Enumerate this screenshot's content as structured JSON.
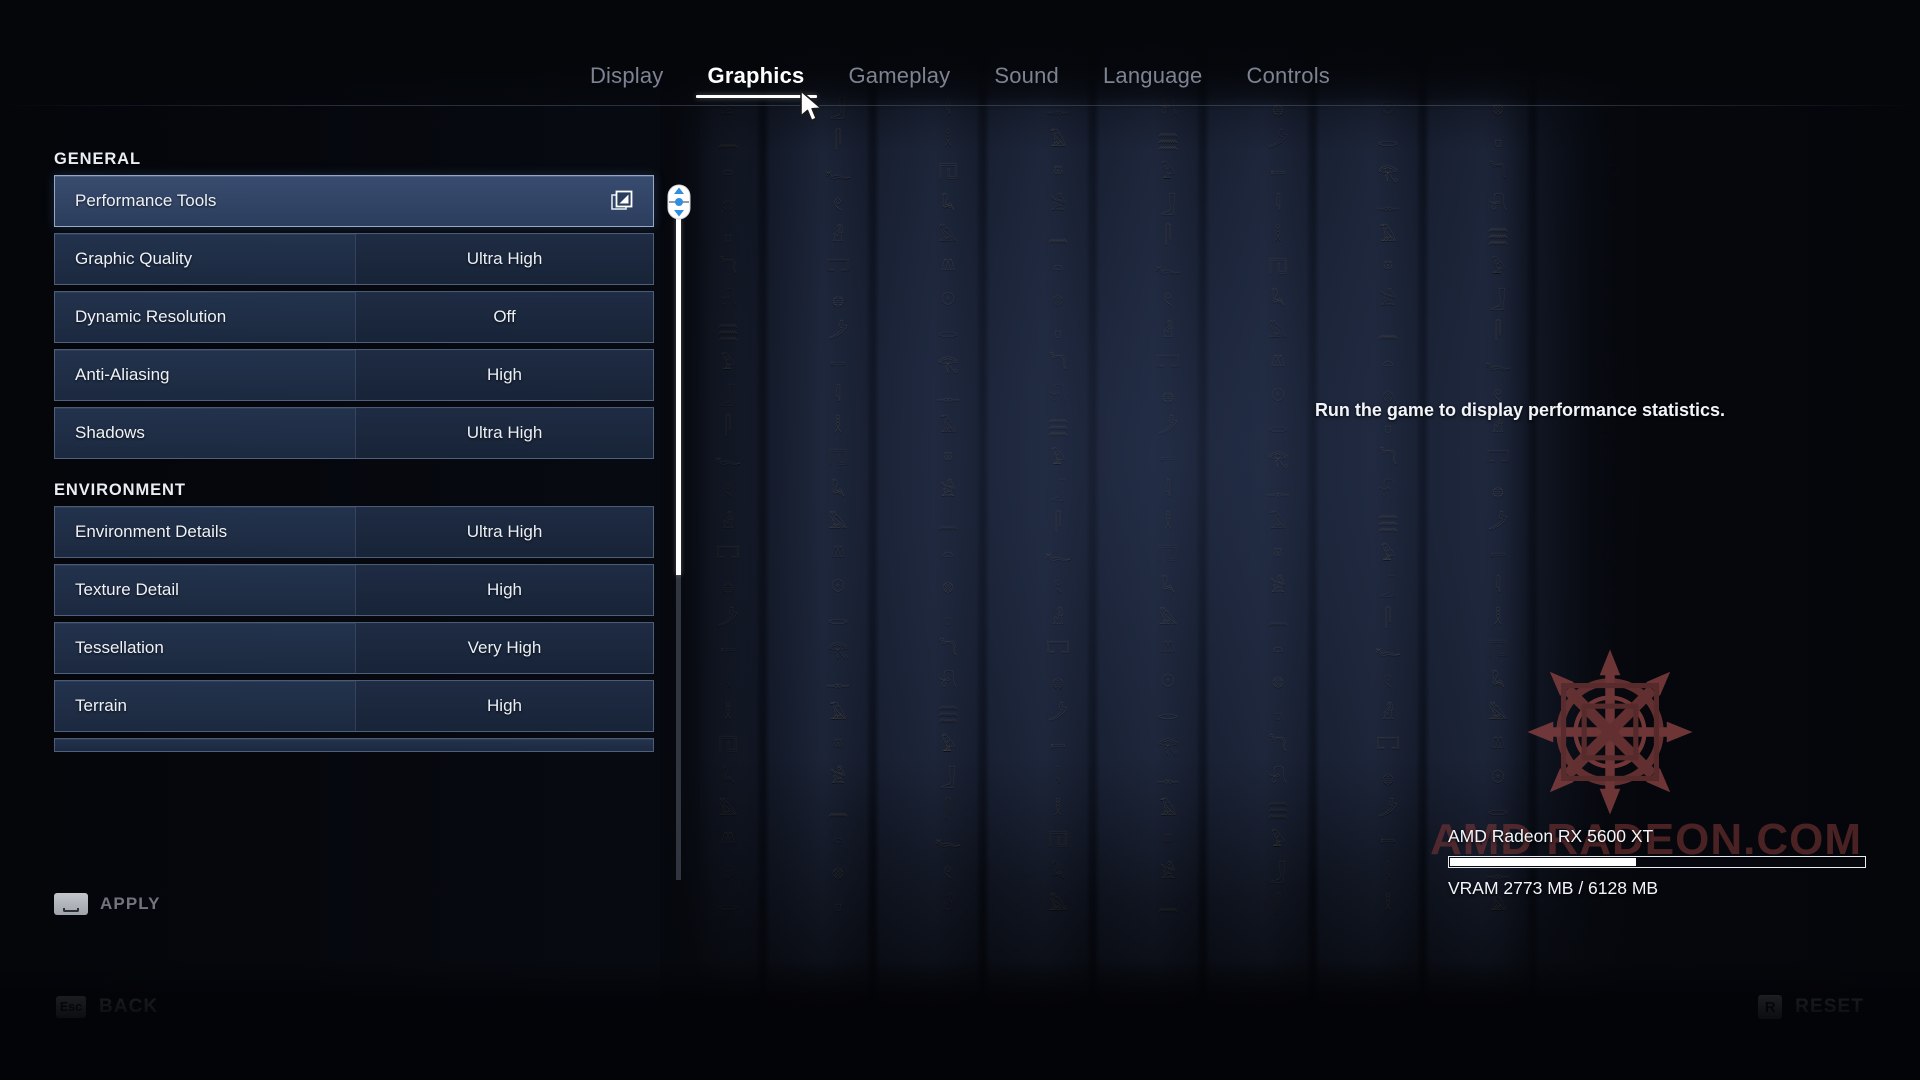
{
  "nav": {
    "tabs": [
      {
        "label": "Display",
        "active": false
      },
      {
        "label": "Graphics",
        "active": true
      },
      {
        "label": "Gameplay",
        "active": false
      },
      {
        "label": "Sound",
        "active": false
      },
      {
        "label": "Language",
        "active": false
      },
      {
        "label": "Controls",
        "active": false
      }
    ]
  },
  "settings": {
    "sections": [
      {
        "title": "GENERAL",
        "rows": [
          {
            "label": "Performance Tools",
            "value": "",
            "icon": "open-window-icon",
            "selected": true
          },
          {
            "label": "Graphic Quality",
            "value": "Ultra High",
            "selected": false
          },
          {
            "label": "Dynamic Resolution",
            "value": "Off",
            "selected": false
          },
          {
            "label": "Anti-Aliasing",
            "value": "High",
            "selected": false
          },
          {
            "label": "Shadows",
            "value": "Ultra High",
            "selected": false
          }
        ]
      },
      {
        "title": "ENVIRONMENT",
        "rows": [
          {
            "label": "Environment Details",
            "value": "Ultra High",
            "selected": false
          },
          {
            "label": "Texture Detail",
            "value": "High",
            "selected": false
          },
          {
            "label": "Tessellation",
            "value": "Very High",
            "selected": false
          },
          {
            "label": "Terrain",
            "value": "High",
            "selected": false
          }
        ]
      }
    ]
  },
  "apply": {
    "key": "space",
    "label": "APPLY"
  },
  "performance": {
    "message": "Run the game to display performance statistics.",
    "gpu_name": "AMD Radeon RX 5600 XT",
    "vram_text": "VRAM 2773 MB / 6128 MB",
    "vram_used_mb": 2773,
    "vram_total_mb": 6128,
    "vram_percent": 45,
    "watermark": "AMD RADEON.COM"
  },
  "footer": {
    "back": {
      "key": "Esc",
      "label": "BACK"
    },
    "reset": {
      "key": "R",
      "label": "RESET"
    }
  },
  "colors": {
    "accent_row": "#3a4f73",
    "row_bg": "#263652",
    "row_border": "#96aacd",
    "text": "#eef2f8",
    "muted_tab": "#7d8391",
    "scroll_thumb": "#ffffff",
    "vram_fill": "#ffffff",
    "watermark": "#843838"
  },
  "scroll": {
    "thumb_percent": 54
  }
}
